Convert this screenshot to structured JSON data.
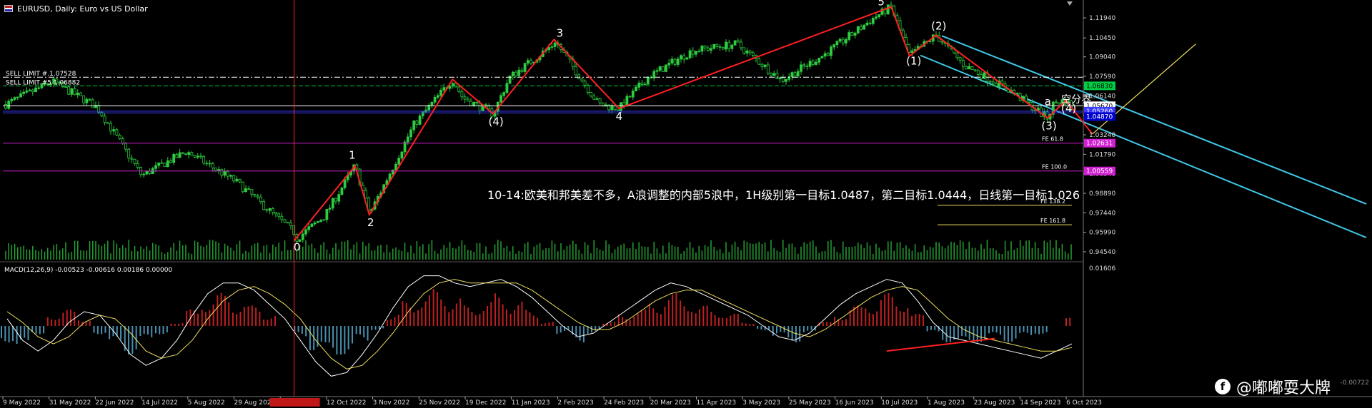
{
  "window": {
    "title": "EURUSD, Daily:  Euro vs US Dollar",
    "watermark": "@嘟嘟耍大牌",
    "corner_label": "-0.00722"
  },
  "colors": {
    "background": "#000000",
    "candle": "#2ecc40",
    "wave": "#ff2020",
    "channel": "#40c8e8",
    "level_green": "#00cc44",
    "level_magenta": "#d020d0",
    "level_white": "#ffffff",
    "level_blue": "#3b3bff",
    "crosshair": "#ff2020",
    "projection": "#f0e060",
    "macd_up": "#c02020",
    "macd_down": "#4a90b0"
  },
  "chart_data": {
    "type": "line",
    "symbol": "EURUSD",
    "timeframe": "Daily",
    "x_ticks": [
      "9 May 2022",
      "31 May 2022",
      "22 Jun 2022",
      "14 Jul 2022",
      "5 Aug 2022",
      "29 Aug 2022",
      "",
      "12 Oct 2022",
      "3 Nov 2022",
      "25 Nov 2022",
      "19 Dec 2022",
      "11 Jan 2023",
      "2 Feb 2023",
      "24 Feb 2023",
      "20 Mar 2023",
      "11 Apr 2023",
      "3 May 2023",
      "25 May 2023",
      "16 Jun 2023",
      "10 Jul 2023",
      "1 Aug 2023",
      "23 Aug 2023",
      "14 Sep 2023",
      "6 Oct 2023"
    ],
    "crosshair_date_label": "",
    "y_ticks": [
      "1.11940",
      "1.10450",
      "1.09040",
      "1.07590",
      "1.06140",
      "1.04690",
      "1.03240",
      "1.01790",
      "1.00340",
      "0.98890",
      "0.97440",
      "0.95990",
      "0.94540"
    ],
    "ylim": [
      0.9385,
      1.1295
    ],
    "price_series": [
      {
        "d": "9 May 2022",
        "c": 1.055
      },
      {
        "d": "31 May 2022",
        "c": 1.072
      },
      {
        "d": "22 Jun 2022",
        "c": 1.053
      },
      {
        "d": "14 Jul 2022",
        "c": 1.002
      },
      {
        "d": "5 Aug 2022",
        "c": 1.02
      },
      {
        "d": "29 Aug 2022",
        "c": 0.998
      },
      {
        "d": "27 Sep 2022",
        "c": 0.96
      },
      {
        "d": "12 Oct 2022",
        "c": 0.972
      },
      {
        "d": "3 Nov 2022",
        "c": 0.975
      },
      {
        "d": "25 Nov 2022",
        "c": 1.04
      },
      {
        "d": "19 Dec 2022",
        "c": 1.06
      },
      {
        "d": "11 Jan 2023",
        "c": 1.075
      },
      {
        "d": "2 Feb 2023",
        "c": 1.1
      },
      {
        "d": "24 Feb 2023",
        "c": 1.055
      },
      {
        "d": "20 Mar 2023",
        "c": 1.075
      },
      {
        "d": "11 Apr 2023",
        "c": 1.095
      },
      {
        "d": "3 May 2023",
        "c": 1.1
      },
      {
        "d": "25 May 2023",
        "c": 1.073
      },
      {
        "d": "16 Jun 2023",
        "c": 1.093
      },
      {
        "d": "10 Jul 2023",
        "c": 1.12
      },
      {
        "d": "1 Aug 2023",
        "c": 1.097
      },
      {
        "d": "23 Aug 2023",
        "c": 1.084
      },
      {
        "d": "14 Sep 2023",
        "c": 1.066
      },
      {
        "d": "6 Oct 2023",
        "c": 1.056
      }
    ],
    "wave_points": [
      {
        "label": "0",
        "d": "27 Sep 2022",
        "y": 0.9536
      },
      {
        "label": "1",
        "d": "27 Oct 2022",
        "y": 1.0094
      },
      {
        "label": "2",
        "d": "3 Nov 2022",
        "y": 0.973
      },
      {
        "label": "3",
        "d": "2 Feb 2023",
        "y": 1.1033
      },
      {
        "label": "(4)",
        "d": "3 Jan 2023",
        "y": 1.048
      },
      {
        "label": "4",
        "d": "6 Mar 2023",
        "y": 1.052
      },
      {
        "label": "5",
        "d": "18 Jul 2023",
        "y": 1.1276
      },
      {
        "label": "(1)",
        "d": "27 Jul 2023",
        "y": 1.091
      },
      {
        "label": "(2)",
        "d": "9 Aug 2023",
        "y": 1.1065
      },
      {
        "label": "(3)",
        "d": "3 Oct 2023",
        "y": 1.0448
      },
      {
        "label": "(4)",
        "d": "12 Oct 2023",
        "y": 1.058
      }
    ],
    "wave_path": [
      {
        "d": "27 Sep 2022",
        "y": 0.9536
      },
      {
        "d": "27 Oct 2022",
        "y": 1.0094
      },
      {
        "d": "3 Nov 2022",
        "y": 0.973
      },
      {
        "d": "14 Dec 2022",
        "y": 1.0736
      },
      {
        "d": "3 Jan 2023",
        "y": 1.048
      },
      {
        "d": "2 Feb 2023",
        "y": 1.1033
      },
      {
        "d": "6 Mar 2023",
        "y": 1.052
      },
      {
        "d": "18 Jul 2023",
        "y": 1.1276
      },
      {
        "d": "27 Jul 2023",
        "y": 1.091
      },
      {
        "d": "9 Aug 2023",
        "y": 1.1065
      },
      {
        "d": "3 Oct 2023",
        "y": 1.0448
      },
      {
        "d": "12 Oct 2023",
        "y": 1.058
      },
      {
        "d": "25 Oct 2023",
        "y": 1.033
      }
    ],
    "projection": [
      {
        "d": "25 Oct 2023",
        "y": 1.033
      },
      {
        "d": "15 Dec 2023",
        "y": 1.1
      }
    ],
    "levels": [
      {
        "label": "SELL LIMIT #.1.07528",
        "y": 1.07528,
        "style": "dashdot",
        "color": "level_white"
      },
      {
        "label": "SELL LIMIT #5 1.06882",
        "y": 1.06882,
        "style": "dash",
        "color": "level_green"
      },
      {
        "label": "",
        "y": 1.054,
        "style": "solid",
        "color": "level_white"
      },
      {
        "label": "",
        "y": 1.05,
        "style": "solid",
        "color": "level_blue"
      },
      {
        "label": "",
        "y": 1.0487,
        "style": "solid",
        "color": "level_blue"
      },
      {
        "label": "FE 61.8",
        "y": 1.0262,
        "style": "solid",
        "color": "level_magenta"
      },
      {
        "label": "FE 100.0",
        "y": 1.0055,
        "style": "solid",
        "color": "level_magenta"
      }
    ],
    "fe_short": [
      {
        "label": "FE 138.2",
        "y": 0.98
      },
      {
        "label": "FE 161.8",
        "y": 0.9655
      }
    ],
    "right_badges": [
      {
        "text": "1.06830",
        "y": 1.06882,
        "bg": "#00cc44",
        "fg": "#000000"
      },
      {
        "text": "1.05670",
        "y": 1.054,
        "bg": "#ffffff",
        "fg": "#000000"
      },
      {
        "text": "1.05260",
        "y": 1.05,
        "bg": "#3b3bff",
        "fg": "#ffffff"
      },
      {
        "text": "1.04870",
        "y": 1.046,
        "bg": "#0000cc",
        "fg": "#ffffff"
      },
      {
        "text": "1.02631",
        "y": 1.0262,
        "bg": "#d020d0",
        "fg": "#ffffff"
      },
      {
        "text": "1.00559",
        "y": 1.0055,
        "bg": "#d020d0",
        "fg": "#ffffff"
      }
    ],
    "annotations": [
      {
        "text": "10-14:欧美和邦美差不多，A浪调整的内部5浪中，1H级别第一目标1.0487，第二目标1.0444，日线第一目标1.026"
      },
      {
        "text": "a"
      },
      {
        "text": "空分界"
      }
    ],
    "macd": {
      "label": "MACD(12,26,9) -0.00523 -0.00616 0.00186 0.00000",
      "y_ticks": [
        "0.01606",
        "-0.00722"
      ],
      "ylim": [
        -0.0185,
        0.0175
      ],
      "hist": [
        -0.004,
        -0.006,
        -0.002,
        0.003,
        0.004,
        0.002,
        -0.002,
        -0.005,
        -0.007,
        -0.004,
        -0.002,
        0.001,
        0.004,
        0.007,
        0.008,
        0.006,
        0.005,
        0.003,
        0.0,
        -0.003,
        -0.006,
        -0.008,
        -0.007,
        -0.004,
        -0.001,
        0.003,
        0.006,
        0.008,
        0.009,
        0.007,
        0.005,
        0.006,
        0.008,
        0.006,
        0.004,
        0.001,
        -0.002,
        -0.004,
        -0.002,
        0.001,
        0.003,
        0.004,
        0.006,
        0.008,
        0.007,
        0.005,
        0.004,
        0.003,
        0.001,
        -0.001,
        -0.003,
        -0.004,
        -0.002,
        0.001,
        0.003,
        0.005,
        0.006,
        0.008,
        0.007,
        0.003,
        -0.002,
        -0.004,
        -0.005,
        -0.004,
        -0.003,
        -0.004,
        -0.003,
        -0.002,
        0.0,
        0.002
      ],
      "macd_line": [
        0.002,
        -0.004,
        -0.007,
        -0.004,
        0.001,
        0.004,
        0.003,
        -0.002,
        -0.008,
        -0.011,
        -0.009,
        -0.004,
        0.003,
        0.009,
        0.012,
        0.012,
        0.01,
        0.006,
        0.002,
        -0.004,
        -0.01,
        -0.014,
        -0.013,
        -0.008,
        -0.002,
        0.005,
        0.011,
        0.014,
        0.014,
        0.012,
        0.011,
        0.012,
        0.013,
        0.011,
        0.008,
        0.004,
        0.0,
        -0.003,
        -0.002,
        0.001,
        0.004,
        0.007,
        0.01,
        0.012,
        0.011,
        0.009,
        0.007,
        0.005,
        0.003,
        0.0,
        -0.003,
        -0.004,
        -0.002,
        0.002,
        0.006,
        0.009,
        0.011,
        0.013,
        0.012,
        0.007,
        0.001,
        -0.003,
        -0.004,
        -0.005,
        -0.006,
        -0.007,
        -0.008,
        -0.009,
        -0.007,
        -0.005
      ],
      "signal_line": [
        0.004,
        0.001,
        -0.003,
        -0.005,
        -0.003,
        0.001,
        0.003,
        0.002,
        -0.002,
        -0.007,
        -0.009,
        -0.008,
        -0.004,
        0.002,
        0.007,
        0.01,
        0.011,
        0.009,
        0.006,
        0.002,
        -0.004,
        -0.009,
        -0.012,
        -0.011,
        -0.007,
        -0.002,
        0.004,
        0.009,
        0.012,
        0.013,
        0.012,
        0.012,
        0.012,
        0.012,
        0.01,
        0.007,
        0.004,
        0.001,
        -0.001,
        -0.001,
        0.001,
        0.004,
        0.007,
        0.009,
        0.01,
        0.01,
        0.008,
        0.006,
        0.004,
        0.002,
        0.0,
        -0.002,
        -0.003,
        -0.001,
        0.002,
        0.005,
        0.008,
        0.01,
        0.011,
        0.01,
        0.006,
        0.002,
        -0.001,
        -0.003,
        -0.004,
        -0.005,
        -0.006,
        -0.007,
        -0.007,
        -0.006
      ],
      "trend_line": [
        {
          "i": 57,
          "v": -0.007
        },
        {
          "i": 64,
          "v": -0.0035
        }
      ]
    }
  }
}
